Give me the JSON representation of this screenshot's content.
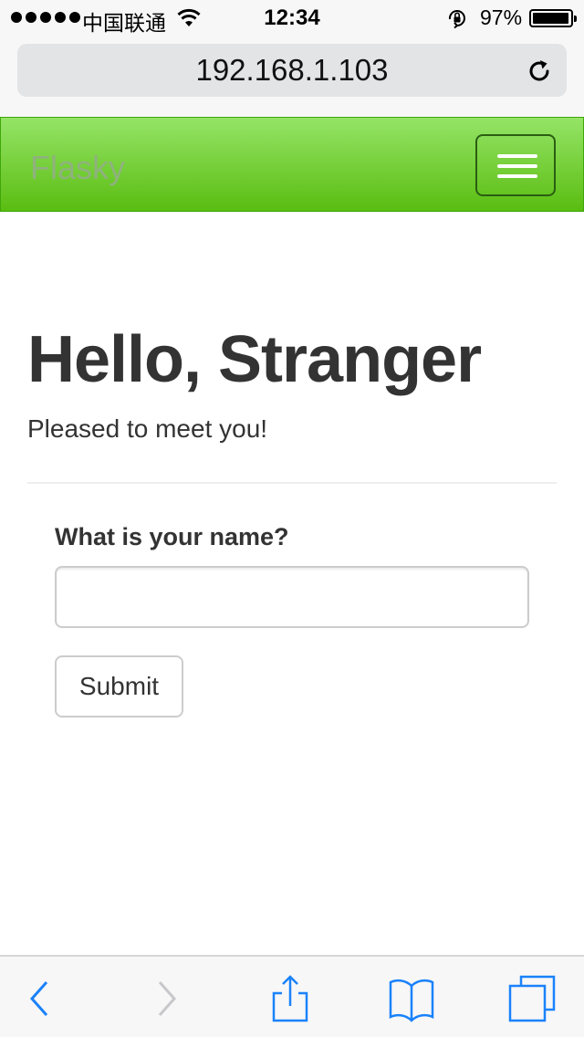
{
  "status_bar": {
    "carrier": "中国联通",
    "time": "12:34",
    "battery_percent": "97%",
    "battery_level": 0.97,
    "signal_dots": 5
  },
  "browser": {
    "url": "192.168.1.103",
    "icons": {
      "reload": "reload-icon",
      "back": "back-arrow-icon",
      "forward": "forward-arrow-icon",
      "share": "share-icon",
      "bookmarks": "bookmarks-icon",
      "tabs": "tabs-icon"
    }
  },
  "navbar": {
    "brand": "Flasky",
    "toggle_icon": "hamburger-menu-icon",
    "gradient_top": "#95e467",
    "gradient_bottom": "#5abd11"
  },
  "page": {
    "title": "Hello, Stranger",
    "subtitle": "Pleased to meet you!"
  },
  "form": {
    "label": "What is your name?",
    "name_value": "",
    "placeholder": "",
    "submit_label": "Submit"
  },
  "colors": {
    "ios_blue": "#1a82fb",
    "disabled_gray": "#c7c7cc",
    "text": "#333333"
  }
}
